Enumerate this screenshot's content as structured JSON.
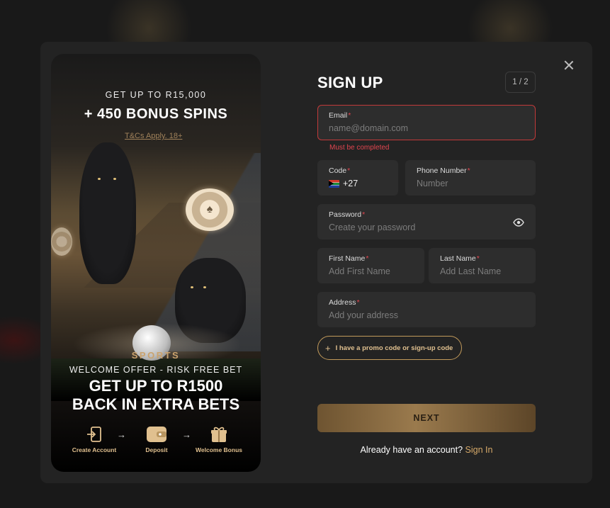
{
  "promo": {
    "headline_small": "GET UP TO R15,000",
    "headline_big": "+ 450 BONUS SPINS",
    "terms_link": "T&Cs Apply. 18+",
    "category": "SPORTS",
    "offer_line": "WELCOME OFFER - RISK FREE BET",
    "main_line1": "GET UP TO R1500",
    "main_line2": "BACK IN EXTRA BETS",
    "steps": [
      {
        "label": "Create Account",
        "icon": "login-icon"
      },
      {
        "label": "Deposit",
        "icon": "wallet-icon"
      },
      {
        "label": "Welcome Bonus",
        "icon": "gift-icon"
      }
    ],
    "arrow": "→"
  },
  "form": {
    "title": "SIGN UP",
    "step_indicator": "1 / 2",
    "required_mark": "*",
    "email": {
      "label": "Email",
      "placeholder": "name@domain.com",
      "error": "Must be completed"
    },
    "code": {
      "label": "Code",
      "value": "+27",
      "flag": "south-africa-flag-icon"
    },
    "phone": {
      "label": "Phone Number",
      "placeholder": "Number"
    },
    "password": {
      "label": "Password",
      "placeholder": "Create your password"
    },
    "first_name": {
      "label": "First Name",
      "placeholder": "Add First Name"
    },
    "last_name": {
      "label": "Last Name",
      "placeholder": "Add Last Name"
    },
    "address": {
      "label": "Address",
      "placeholder": "Add your address"
    },
    "promo_button": {
      "icon": "+",
      "label": "I have a promo code or sign-up code"
    },
    "next_button": "NEXT",
    "signin_prompt": "Already have an account?",
    "signin_link": "Sign In"
  },
  "colors": {
    "accent": "#d6a969",
    "error": "#e0454f",
    "modal_bg": "#232323",
    "field_bg": "#2d2d2d"
  }
}
